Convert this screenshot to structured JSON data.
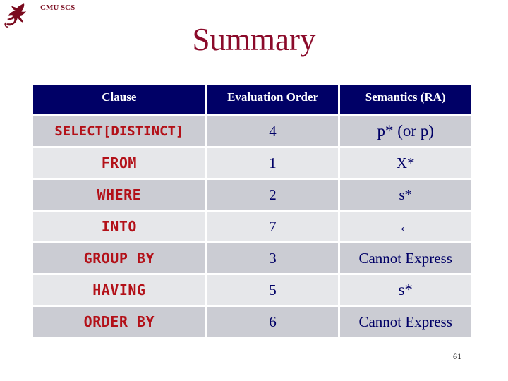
{
  "header": {
    "org_label": "CMU SCS",
    "logo_icon": "dragon-logo-icon"
  },
  "slide": {
    "title": "Summary",
    "page_number": "61"
  },
  "colors": {
    "title": "#8b0a2a",
    "header_bg": "#000066",
    "clause_text": "#b31018",
    "row_dark": "#cbccd3",
    "row_light": "#e6e7ea"
  },
  "table": {
    "columns": [
      "Clause",
      "Evaluation Order",
      "Semantics (RA)"
    ],
    "rows": [
      {
        "clause": "SELECT[DISTINCT]",
        "order": "4",
        "semantics": "p* (or p)"
      },
      {
        "clause": "FROM",
        "order": "1",
        "semantics": "X*"
      },
      {
        "clause": "WHERE",
        "order": "2",
        "semantics": "s*"
      },
      {
        "clause": "INTO",
        "order": "7",
        "semantics": "←"
      },
      {
        "clause": "GROUP BY",
        "order": "3",
        "semantics": "Cannot Express"
      },
      {
        "clause": "HAVING",
        "order": "5",
        "semantics": "s*"
      },
      {
        "clause": "ORDER BY",
        "order": "6",
        "semantics": "Cannot Express"
      }
    ]
  }
}
